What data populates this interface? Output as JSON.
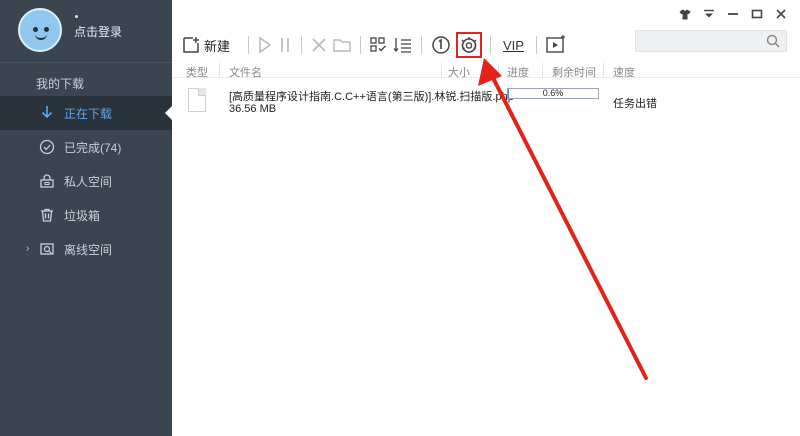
{
  "sidebar": {
    "login_text": "点击登录",
    "section_title": "我的下载",
    "items": [
      {
        "label": "正在下载",
        "icon": "download-arrow-icon",
        "active": true
      },
      {
        "label": "已完成(74)",
        "icon": "check-circle-icon",
        "active": false
      },
      {
        "label": "私人空间",
        "icon": "private-space-icon",
        "active": false
      },
      {
        "label": "垃圾箱",
        "icon": "trash-icon",
        "active": false
      },
      {
        "label": "离线空间",
        "icon": "offline-space-icon",
        "active": false
      }
    ]
  },
  "toolbar": {
    "new_label": "新建",
    "vip_label": "VIP"
  },
  "columns": {
    "type": "类型",
    "filename": "文件名",
    "size": "大小",
    "progress": "进度",
    "remaining": "剩余时间",
    "speed": "速度"
  },
  "download": {
    "filename": "[高质量程序设计指南.C.C++语言(第三版)].林锐.扫描版.php",
    "size": "36.56 MB",
    "progress_text": "0.6%",
    "progress_value": 0.006,
    "status": "任务出错"
  },
  "colors": {
    "sidebar_bg": "#3b4550",
    "active_blue": "#5aa7ec",
    "annotation_red": "#d8281f"
  }
}
